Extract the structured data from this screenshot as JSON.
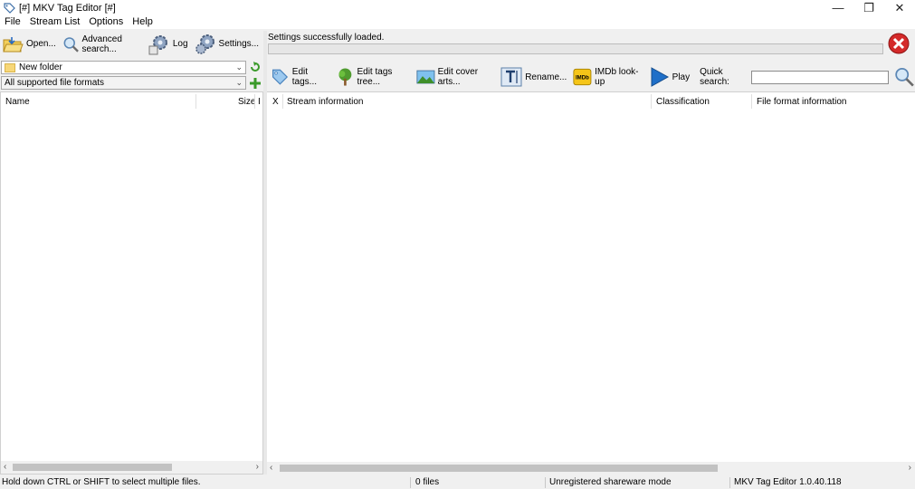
{
  "window": {
    "title": "[#] MKV Tag Editor [#]",
    "minimize": "—",
    "restore": "❐",
    "close": "✕"
  },
  "menu": [
    "File",
    "Stream List",
    "Options",
    "Help"
  ],
  "left_toolbar": {
    "open": "Open...",
    "advanced_search": "Advanced search...",
    "log": "Log",
    "settings": "Settings..."
  },
  "status": {
    "message": "Settings successfully loaded.",
    "progress": 0
  },
  "folder_combo": {
    "value": "New folder"
  },
  "filter_combo": {
    "value": "All supported file formats"
  },
  "file_list": {
    "columns": [
      "Name",
      "Size",
      "I"
    ]
  },
  "right_toolbar": {
    "edit_tags": "Edit tags...",
    "edit_tags_tree": "Edit tags tree...",
    "edit_cover_arts": "Edit cover arts...",
    "rename": "Rename...",
    "imdb_badge": "IMDb",
    "imdb_lookup": "IMDb look-up",
    "play": "Play",
    "quick_search_label": "Quick search:",
    "quick_search_value": ""
  },
  "stream_table": {
    "columns": [
      "X",
      "Stream information",
      "Classification",
      "File format information"
    ]
  },
  "statusbar": {
    "hint": "Hold down CTRL or SHIFT to select multiple files.",
    "count": "0 files",
    "mode": "Unregistered shareware mode",
    "version": "MKV Tag Editor 1.0.40.118"
  },
  "colors": {
    "accent_green": "#3a9a2a",
    "stop_red": "#d42a2a",
    "play_blue": "#1f6fc8",
    "imdb_yellow": "#f5c518"
  }
}
